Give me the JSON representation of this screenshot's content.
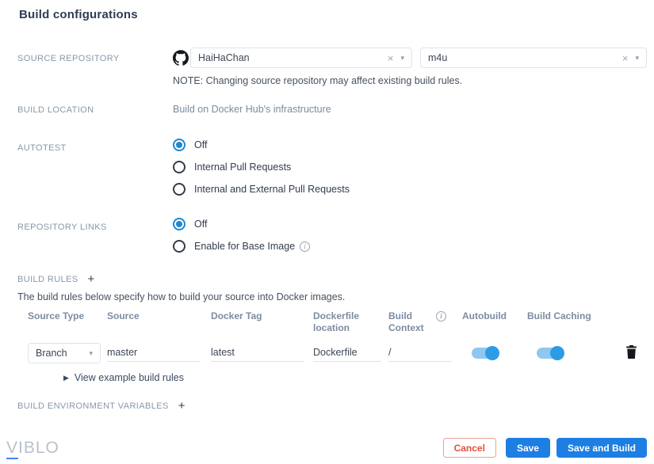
{
  "page": {
    "title": "Build configurations"
  },
  "icons": {
    "clear": "×",
    "caret": "▾",
    "plus": "+",
    "collapsed_arrow": "▶",
    "info": "i"
  },
  "form": {
    "source_repository": {
      "label": "SOURCE REPOSITORY",
      "provider_icon": "github-icon",
      "org_select": {
        "value": "HaiHaChan"
      },
      "repo_select": {
        "value": "m4u"
      },
      "note": "NOTE: Changing source repository may affect existing build rules."
    },
    "build_location": {
      "label": "BUILD LOCATION",
      "value": "Build on Docker Hub's infrastructure"
    },
    "autotest": {
      "label": "AUTOTEST",
      "options": [
        {
          "label": "Off",
          "selected": true
        },
        {
          "label": "Internal Pull Requests",
          "selected": false
        },
        {
          "label": "Internal and External Pull Requests",
          "selected": false
        }
      ]
    },
    "repository_links": {
      "label": "REPOSITORY LINKS",
      "options": [
        {
          "label": "Off",
          "selected": true
        },
        {
          "label": "Enable for Base Image",
          "selected": false,
          "has_info_icon": true
        }
      ]
    },
    "build_rules": {
      "label": "BUILD RULES",
      "description": "The build rules below specify how to build your source into Docker images.",
      "table": {
        "headers": [
          "Source Type",
          "Source",
          "Docker Tag",
          "Dockerfile location",
          "Build Context",
          "Autobuild",
          "Build Caching"
        ],
        "rows": [
          {
            "source_type": "Branch",
            "source": "master",
            "docker_tag": "latest",
            "dockerfile_location": "Dockerfile",
            "build_context": "/",
            "autobuild": true,
            "build_caching": true
          }
        ]
      },
      "example_link": "View example build rules"
    },
    "build_environment_variables": {
      "label": "BUILD ENVIRONMENT VARIABLES"
    }
  },
  "footer": {
    "logo": "VIBLO",
    "cancel_label": "Cancel",
    "save_label": "Save",
    "save_and_build_label": "Save and Build"
  },
  "colors": {
    "primary_blue": "#1d7fe3",
    "radio_blue": "#1e88d2",
    "toggle_knob_blue": "#2d9ce5",
    "toggle_track_blue": "#90c7ee",
    "cancel_red": "#e4513b",
    "section_label_gray": "#8997ab",
    "muted_blue_gray": "#7b8b9e",
    "border_gray": "#dde3ea"
  }
}
